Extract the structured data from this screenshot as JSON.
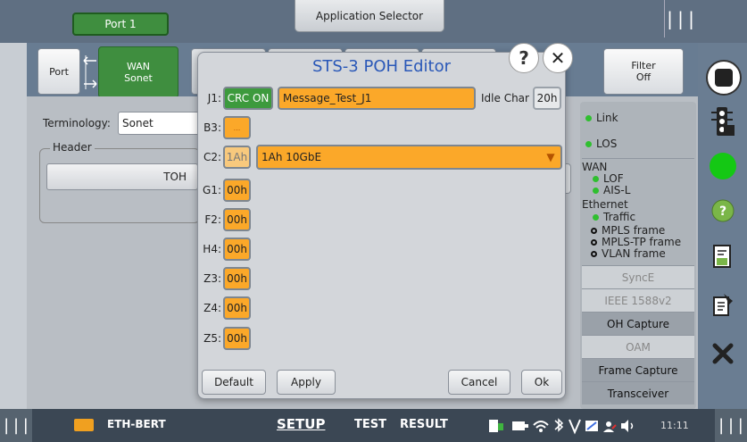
{
  "topbar": {
    "port_tab": "Port 1",
    "app_selector": "Application Selector",
    "grip": "|||"
  },
  "tabs": {
    "port": "Port",
    "wan_line1": "WAN",
    "wan_line2": "Sonet",
    "filter_line1": "Filter",
    "filter_line2": "Off"
  },
  "content": {
    "terminology_label": "Terminology:",
    "terminology_value": "Sonet",
    "header_label": "Header",
    "toh_button": "TOH"
  },
  "status_panel": {
    "link": "Link",
    "los": "LOS",
    "wan": "WAN",
    "lof": "LOF",
    "ais_l": "AIS-L",
    "ethernet": "Ethernet",
    "traffic": "Traffic",
    "mpls": "MPLS frame",
    "mpls_tp": "MPLS-TP frame",
    "vlan": "VLAN frame",
    "synce": "SyncE",
    "ieee": "IEEE 1588v2",
    "oh_capture": "OH Capture",
    "oam": "OAM",
    "frame_capture": "Frame Capture",
    "transceiver": "Transceiver"
  },
  "modal": {
    "title": "STS-3 POH Editor",
    "help": "?",
    "close": "✕",
    "j1_label": "J1:",
    "crc_button": "CRC ON",
    "j1_value": "Message_Test_J1",
    "idle_char_label": "Idle Char",
    "idle_char_value": "20h",
    "b3_label": "B3:",
    "b3_value": "...",
    "c2_label": "C2:",
    "c2_code": "1Ah",
    "c2_value": "1Ah 10GbE",
    "g1_label": "G1:",
    "g1_value": "00h",
    "f2_label": "F2:",
    "f2_value": "00h",
    "h4_label": "H4:",
    "h4_value": "00h",
    "z3_label": "Z3:",
    "z3_value": "00h",
    "z4_label": "Z4:",
    "z4_value": "00h",
    "z5_label": "Z5:",
    "z5_value": "00h",
    "default_button": "Default",
    "apply_button": "Apply",
    "cancel_button": "Cancel",
    "ok_button": "Ok"
  },
  "bottombar": {
    "grip": "|||",
    "app_name": "ETH-BERT",
    "setup": "SETUP",
    "test": "TEST",
    "result": "RESULT",
    "time": "11:11"
  },
  "colors": {
    "accent_green": "#3f8e3f",
    "orange_field": "#fba829",
    "title_blue": "#2a58b8"
  }
}
